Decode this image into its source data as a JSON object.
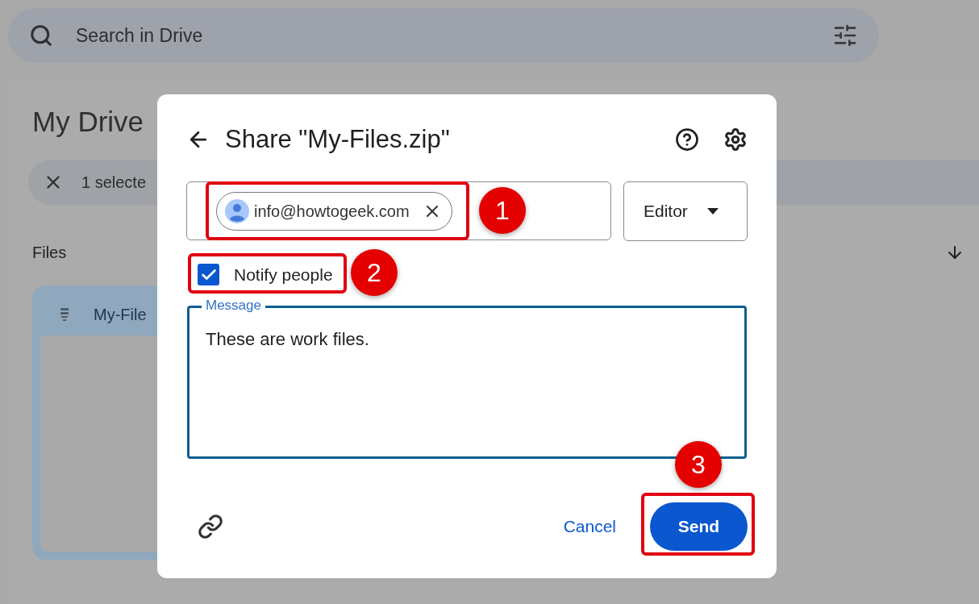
{
  "search": {
    "placeholder": "Search in Drive"
  },
  "page": {
    "title": "My Drive",
    "selection": {
      "count": "1 selecte"
    },
    "section": "Files",
    "file_card": {
      "name": "My-File"
    }
  },
  "dialog": {
    "title": "Share \"My-Files.zip\"",
    "recipients": [
      {
        "email": "info@howtogeek.com"
      }
    ],
    "role": "Editor",
    "notify": {
      "label": "Notify people",
      "checked": true
    },
    "message": {
      "label": "Message",
      "value": "These are work files."
    },
    "buttons": {
      "cancel": "Cancel",
      "send": "Send"
    }
  },
  "annotations": [
    {
      "number": "1"
    },
    {
      "number": "2"
    },
    {
      "number": "3"
    }
  ]
}
